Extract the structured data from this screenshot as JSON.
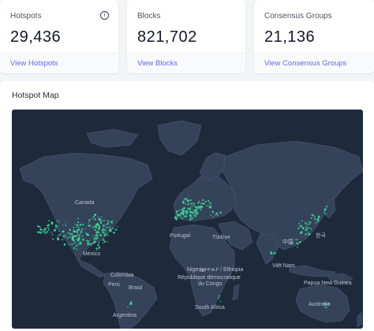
{
  "stats": [
    {
      "label": "Hotspots",
      "value": "29,436",
      "link": "View Hotspots",
      "has_info_icon": true
    },
    {
      "label": "Blocks",
      "value": "821,702",
      "link": "View Blocks"
    },
    {
      "label": "Consensus Groups",
      "value": "21,136",
      "link": "View Consensus Groups"
    }
  ],
  "map": {
    "title": "Hotspot Map",
    "labels": {
      "canada": "Canada",
      "mexico": "México",
      "colombia": "Colombia",
      "peru": "Perú",
      "brasil": "Brasil",
      "argentina": "Argentina",
      "portugal": "Portugal",
      "turkiye": "Türkiye",
      "nigeria": "Nigeria",
      "ethiopia": "ኢትዮጵያ / Ethiopia",
      "drc": "République démocratique",
      "drc2": "du Congo",
      "south_africa": "South Africa",
      "china": "中国",
      "korea": "한국",
      "vietnam": "Việt Nam",
      "png": "Papua New Guinea",
      "australia": "Australia"
    },
    "colors": {
      "background": "#1e2a3c",
      "land": "#34425a",
      "border": "#4a5a75",
      "hotspot": "#3ddc97"
    }
  }
}
